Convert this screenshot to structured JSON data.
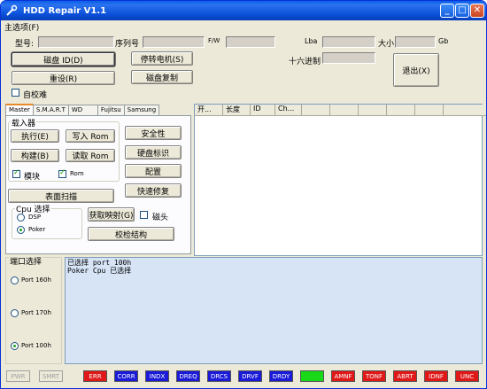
{
  "window": {
    "title": "HDD Repair V1.1",
    "btn_min": "_",
    "btn_max": "□",
    "btn_close": "✕"
  },
  "menu": {
    "options": "主选项(F)"
  },
  "info": {
    "model_label": "型号:",
    "serial_label": "序列号",
    "fw_label": "F/W",
    "lba_label": "Lba",
    "size_label": "大小",
    "size_unit": "Gb",
    "hex_label": "十六进制",
    "model_value": "",
    "serial_value": "",
    "fw_value": "",
    "lba_value": "",
    "size_value": "",
    "hex_value": ""
  },
  "buttons": {
    "disk_id": "磁盘 ID(D)",
    "stop_motor": "停转电机(S)",
    "reset": "重设(R)",
    "disk_copy": "磁盘复制",
    "exit": "退出(X)",
    "self_calib": "自校难"
  },
  "tabs": [
    "Master",
    "S.M.A.R.T",
    "WD",
    "Fujitsu",
    "Samsung"
  ],
  "master": {
    "loader_title": "载入器",
    "execute": "执行(E)",
    "write_rom": "写入 Rom",
    "build": "构建(B)",
    "read_rom": "读取 Rom",
    "module": "模块",
    "rom": "Rom",
    "security": "安全性",
    "disk_label": "硬盘标识",
    "config": "配置",
    "quick_fix": "快速修复",
    "surface_scan": "表面扫描",
    "cpu_title": "Cpu 选择",
    "dsp": "DSP",
    "poker": "Poker",
    "get_map": "获取映射(G)",
    "head": "磁头",
    "checksum": "校检结构"
  },
  "listview": {
    "columns": [
      "开...",
      "长度",
      "ID",
      "Ch..."
    ]
  },
  "ports": {
    "title": "端口选择",
    "p160": "Port 160h",
    "p170": "Port 170h",
    "p100": "Port 100h"
  },
  "log": [
    "已选择 port 100h",
    "Poker Cpu 已选择"
  ],
  "status": [
    {
      "label": "PWR",
      "state": "off"
    },
    {
      "label": "SMRT",
      "state": "off"
    },
    {
      "label": "ERR",
      "state": "red"
    },
    {
      "label": "CORR",
      "state": "blue"
    },
    {
      "label": "INDX",
      "state": "blue"
    },
    {
      "label": "DREQ",
      "state": "blue"
    },
    {
      "label": "DRCS",
      "state": "blue"
    },
    {
      "label": "DRVF",
      "state": "blue"
    },
    {
      "label": "DRDY",
      "state": "blue"
    },
    {
      "label": "",
      "state": "green"
    },
    {
      "label": "AMNF",
      "state": "red"
    },
    {
      "label": "TONF",
      "state": "red"
    },
    {
      "label": "ABRT",
      "state": "red"
    },
    {
      "label": "IDNF",
      "state": "red"
    },
    {
      "label": "UNC",
      "state": "red"
    }
  ]
}
